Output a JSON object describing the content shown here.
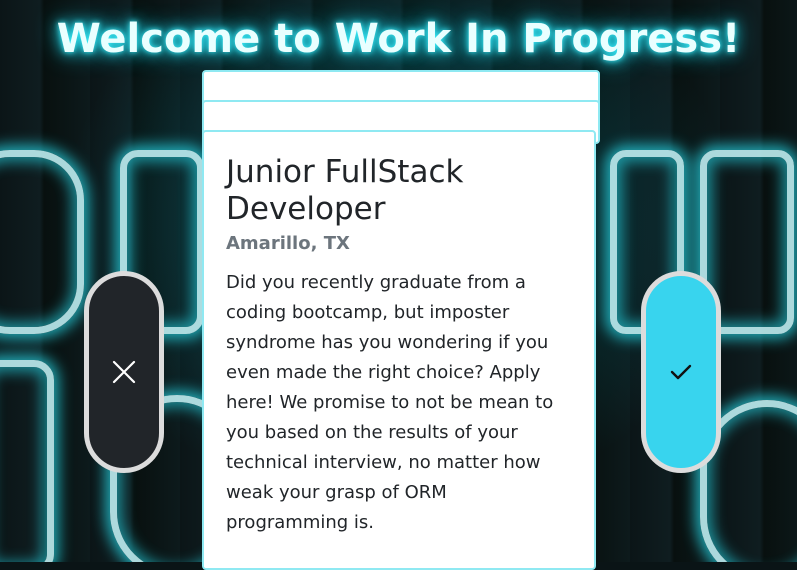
{
  "header": {
    "title": "Welcome to Work In Progress!"
  },
  "job": {
    "title": "Junior FullStack Developer",
    "location": "Amarillo, TX",
    "description": "Did you recently graduate from a coding bootcamp, but imposter syndrome has you wondering if you even made the right choice? Apply here! We promise to not be mean to you based on the results of your technical interview, no matter how weak your grasp of ORM programming is."
  },
  "actions": {
    "reject_icon": "close-icon",
    "accept_icon": "check-icon"
  },
  "colors": {
    "accent": "#38d4ee",
    "reject_bg": "#212529",
    "neon": "#3ff2ff"
  }
}
